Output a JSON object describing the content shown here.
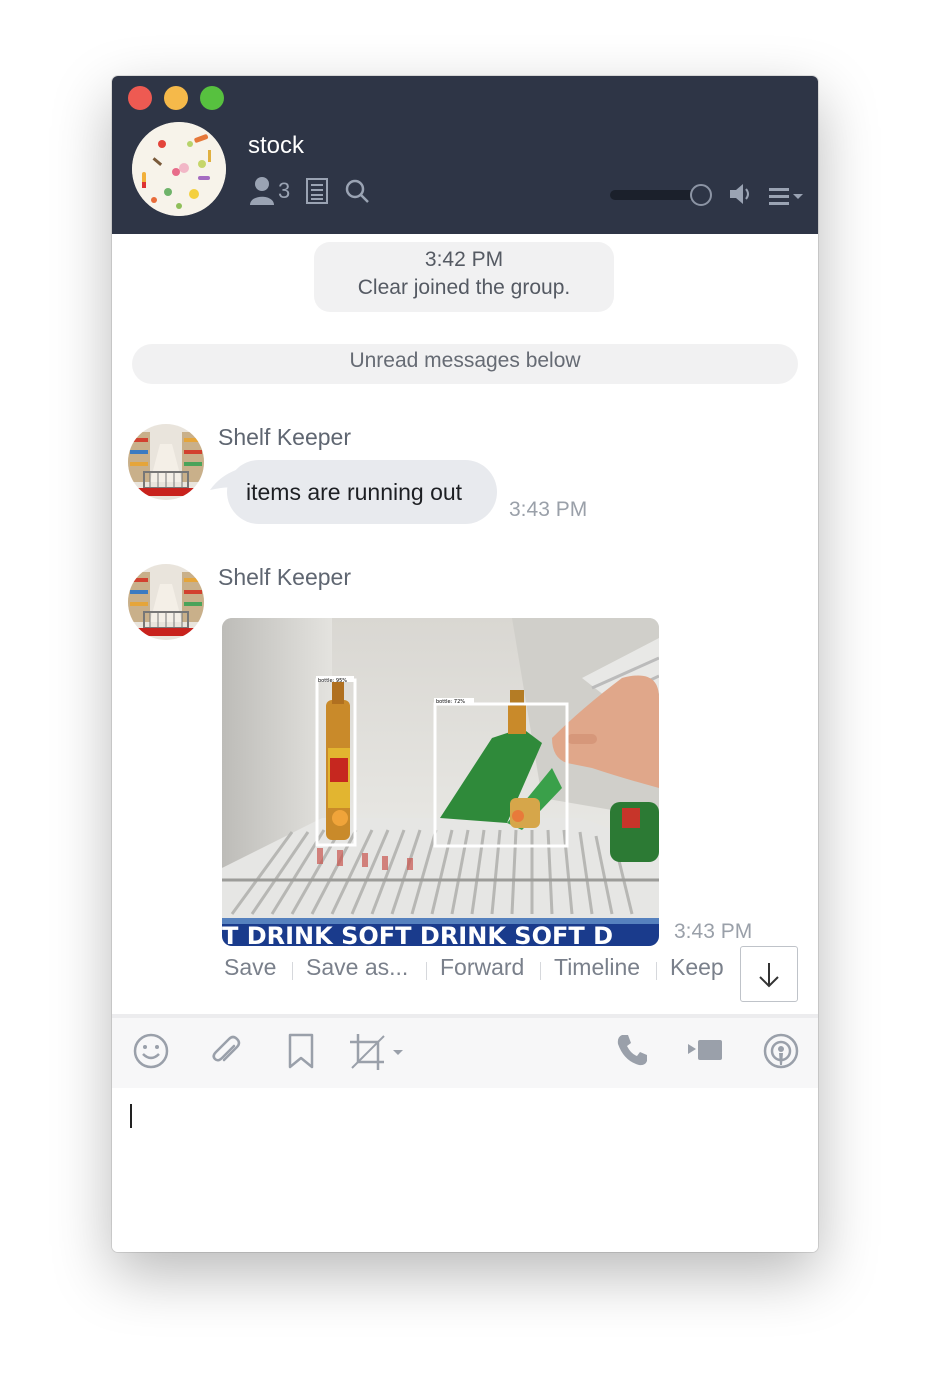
{
  "window": {
    "group_name": "stock",
    "member_count": "3"
  },
  "messages": {
    "system": {
      "time": "3:42 PM",
      "text": "Clear joined the group."
    },
    "unread_label": "Unread messages below",
    "items": [
      {
        "sender": "Shelf Keeper",
        "text": "items are running out",
        "time": "3:43 PM"
      },
      {
        "sender": "Shelf Keeper",
        "time": "3:43 PM",
        "image": {
          "detections": [
            "bottle: 95%",
            "bottle: 72%"
          ],
          "banner_text": "T DRINK   SOFT DRINK  SOFT D"
        }
      }
    ]
  },
  "image_actions": [
    "Save",
    "Save as...",
    "Forward",
    "Timeline",
    "Keep"
  ],
  "icons": {
    "header": [
      "member-icon",
      "note-icon",
      "search-icon",
      "volume-icon",
      "menu-icon"
    ],
    "toolbar": [
      "emoji-icon",
      "attachment-icon",
      "bookmark-icon",
      "crop-icon",
      "phone-icon",
      "video-icon",
      "live-icon"
    ]
  },
  "colors": {
    "header_bg": "#2e3546",
    "bubble_bg": "#e8eaee"
  }
}
